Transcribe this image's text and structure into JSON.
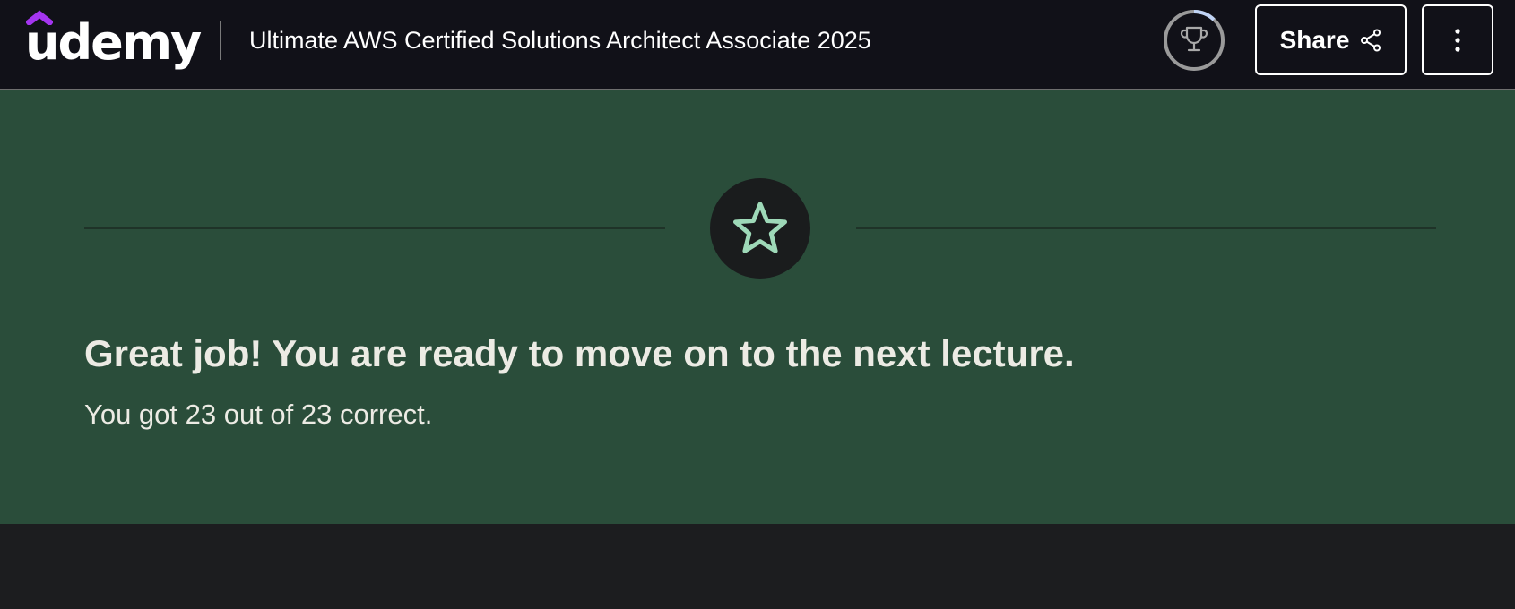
{
  "header": {
    "logo_text": "udemy",
    "course_title": "Ultimate AWS Certified Solutions Architect Associate 2025",
    "progress_icon": "trophy-icon",
    "share_label": "Share",
    "share_icon": "share-icon",
    "more_icon": "vertical-dots-icon"
  },
  "quiz_result": {
    "icon": "star-icon",
    "headline": "Great job! You are ready to move on to the next lecture.",
    "score_text": "You got 23 out of 23 correct."
  },
  "colors": {
    "brand_purple": "#a435f0",
    "banner_green": "#2a4d3a",
    "star_mint": "#9ed9b8",
    "topbar_bg": "#111118"
  }
}
